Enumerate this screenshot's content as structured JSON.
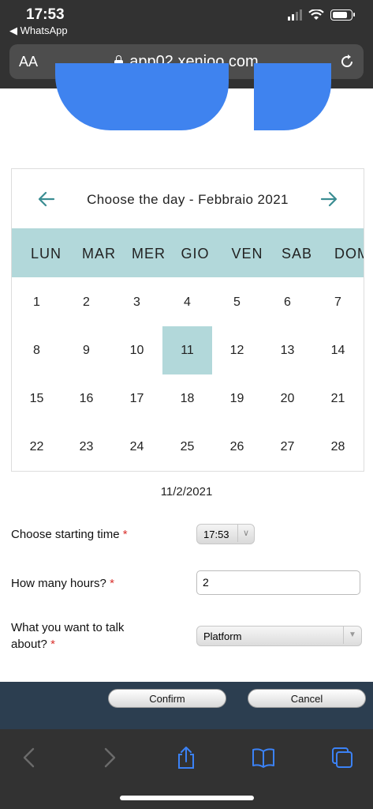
{
  "status": {
    "time": "17:53",
    "back_app": "◀ WhatsApp"
  },
  "browser": {
    "text_size_label": "AA",
    "url": "app02.xenioo.com"
  },
  "calendar": {
    "title": "Choose the day - Febbraio 2021",
    "weekdays": [
      "LUN",
      "MAR",
      "MER",
      "GIO",
      "VEN",
      "SAB",
      "DOM"
    ],
    "weeks": [
      [
        "1",
        "2",
        "3",
        "4",
        "5",
        "6",
        "7"
      ],
      [
        "8",
        "9",
        "10",
        "11",
        "12",
        "13",
        "14"
      ],
      [
        "15",
        "16",
        "17",
        "18",
        "19",
        "20",
        "21"
      ],
      [
        "22",
        "23",
        "24",
        "25",
        "26",
        "27",
        "28"
      ]
    ],
    "selected_day": "11",
    "accent_color": "#b2d8da",
    "arrow_color": "#3b8d92"
  },
  "form": {
    "selected_date": "11/2/2021",
    "start_time_label": "Choose starting time",
    "start_time_value": "17:53",
    "hours_label": "How many hours?",
    "hours_value": "2",
    "topic_label_line1": "What you want to talk",
    "topic_label_line2": "about?",
    "topic_value": "Platform",
    "required_mark": "*"
  },
  "footer": {
    "confirm_label": "Confirm",
    "cancel_label": "Cancel"
  },
  "colors": {
    "logo_blue": "#3f83ef",
    "footer_bg": "#2c3e50",
    "ios_blue": "#3b82f6"
  }
}
